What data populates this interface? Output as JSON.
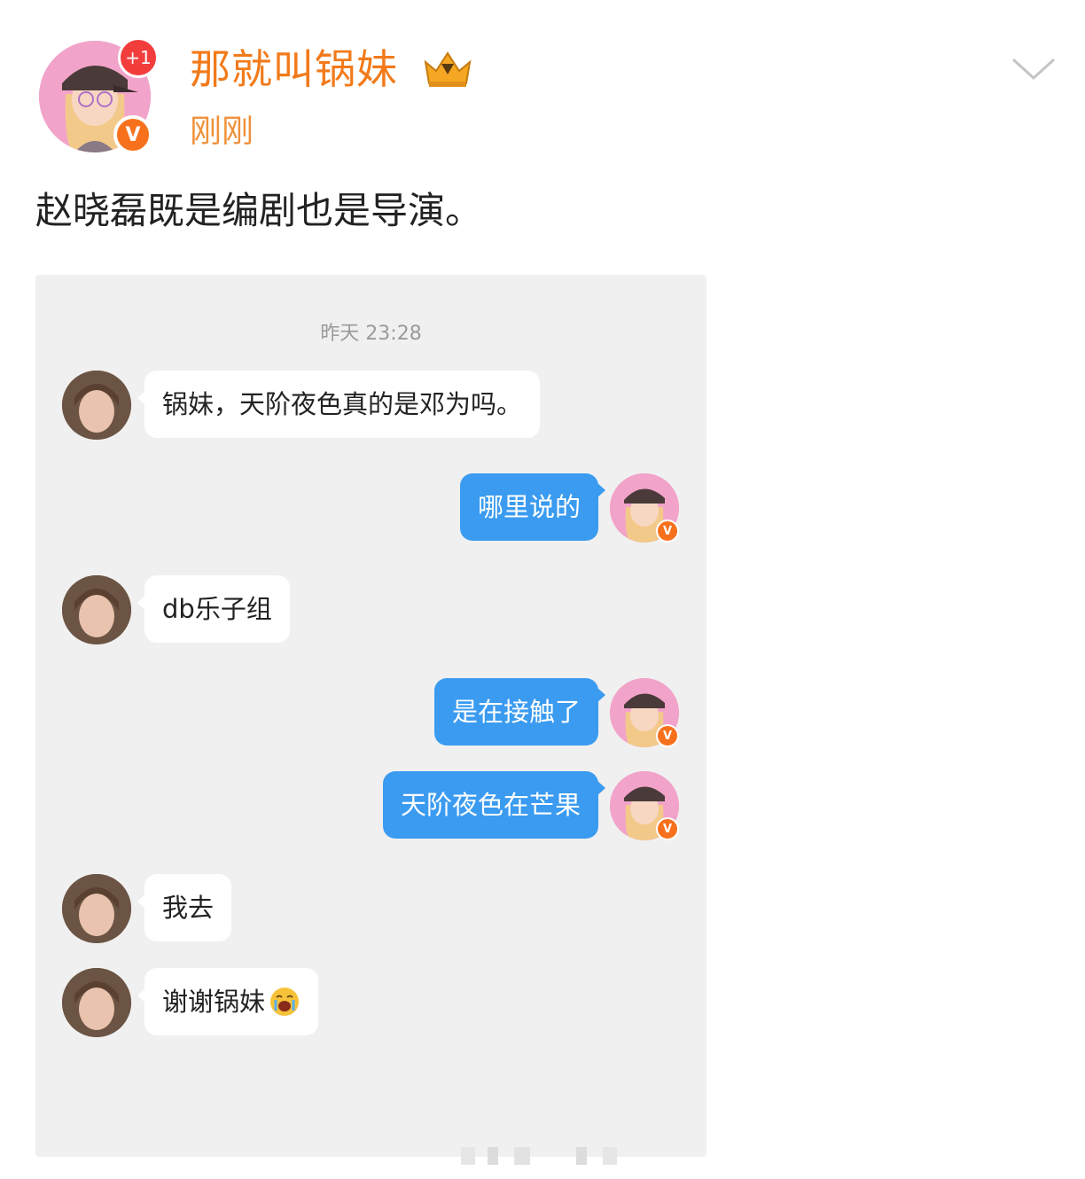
{
  "post": {
    "username": "那就叫锅妹",
    "notification_badge": "+1",
    "verified_mark": "V",
    "time": "刚刚",
    "text": "赵晓磊既是编剧也是导演。"
  },
  "chat": {
    "timestamp": "昨天 23:28",
    "messages": [
      {
        "side": "in",
        "text": "锅妹，天阶夜色真的是邓为吗。"
      },
      {
        "side": "out",
        "text": "哪里说的"
      },
      {
        "side": "in",
        "text": "db乐子组"
      },
      {
        "side": "out",
        "text": "是在接触了"
      },
      {
        "side": "out",
        "text": "天阶夜色在芒果"
      },
      {
        "side": "in",
        "text": "我去"
      },
      {
        "side": "in",
        "text": "谢谢锅妹",
        "emoji": "crying-face-emoji"
      }
    ]
  },
  "colors": {
    "username": "#f27a1a",
    "time": "#f0913a",
    "outgoing_bubble": "#3a9bf0",
    "chat_background": "#f0f0f0"
  }
}
